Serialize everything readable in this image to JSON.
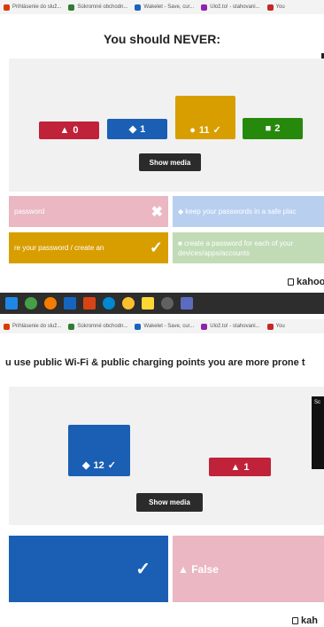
{
  "top_bookmarks": [
    "Prihlásenie do služ...",
    "Súkromné obchodn...",
    "Wakelet - Save, cur...",
    "Ulož.to! - stahovani...",
    "You"
  ],
  "q1": {
    "title": "You should NEVER:",
    "bars": [
      {
        "symbol": "▲",
        "count": "0",
        "color": "#c0223a",
        "correct": false,
        "value": 0
      },
      {
        "symbol": "◆",
        "count": "1",
        "color": "#1a5fb4",
        "correct": false,
        "value": 1
      },
      {
        "symbol": "●",
        "count": "11",
        "color": "#d89e00",
        "correct": true,
        "value": 11
      },
      {
        "symbol": "■",
        "count": "2",
        "color": "#26890c",
        "correct": false,
        "value": 2
      }
    ],
    "check": "✓",
    "show_media": "Show media",
    "answers": [
      {
        "text": "password",
        "mark": "✖",
        "color": "#eab7c3"
      },
      {
        "text": "◆ keep your passwords in a safe plac",
        "mark": "",
        "color": "#b8cff0"
      },
      {
        "text": "re your password / create an",
        "mark": "✓",
        "color": "#d89e00"
      },
      {
        "text": "■ create a password for each of your devices/apps/accounts",
        "mark": "",
        "color": "#c1dbb7"
      }
    ],
    "brand": "kahoot"
  },
  "bottom_bookmarks": [
    "Prihlásenie do služ...",
    "Súkromné obchodn...",
    "Wakelet - Save, cur...",
    "Ulož.to! - stahovani...",
    "You"
  ],
  "q2": {
    "title": "u use public Wi-Fi & public charging points you are more prone t",
    "bars": [
      {
        "symbol": "◆",
        "count": "12",
        "color": "#1a5fb4",
        "correct": true,
        "value": 12
      },
      {
        "symbol": "▲",
        "count": "1",
        "color": "#c0223a",
        "correct": false,
        "value": 1
      }
    ],
    "check": "✓",
    "side_label": "Sc",
    "show_media": "Show media",
    "answers": [
      {
        "text": "",
        "mark": "✓",
        "color": "#1a5fb4"
      },
      {
        "text": "▲ False",
        "mark": "",
        "color": "#eab7c3"
      }
    ],
    "brand": "kah"
  }
}
